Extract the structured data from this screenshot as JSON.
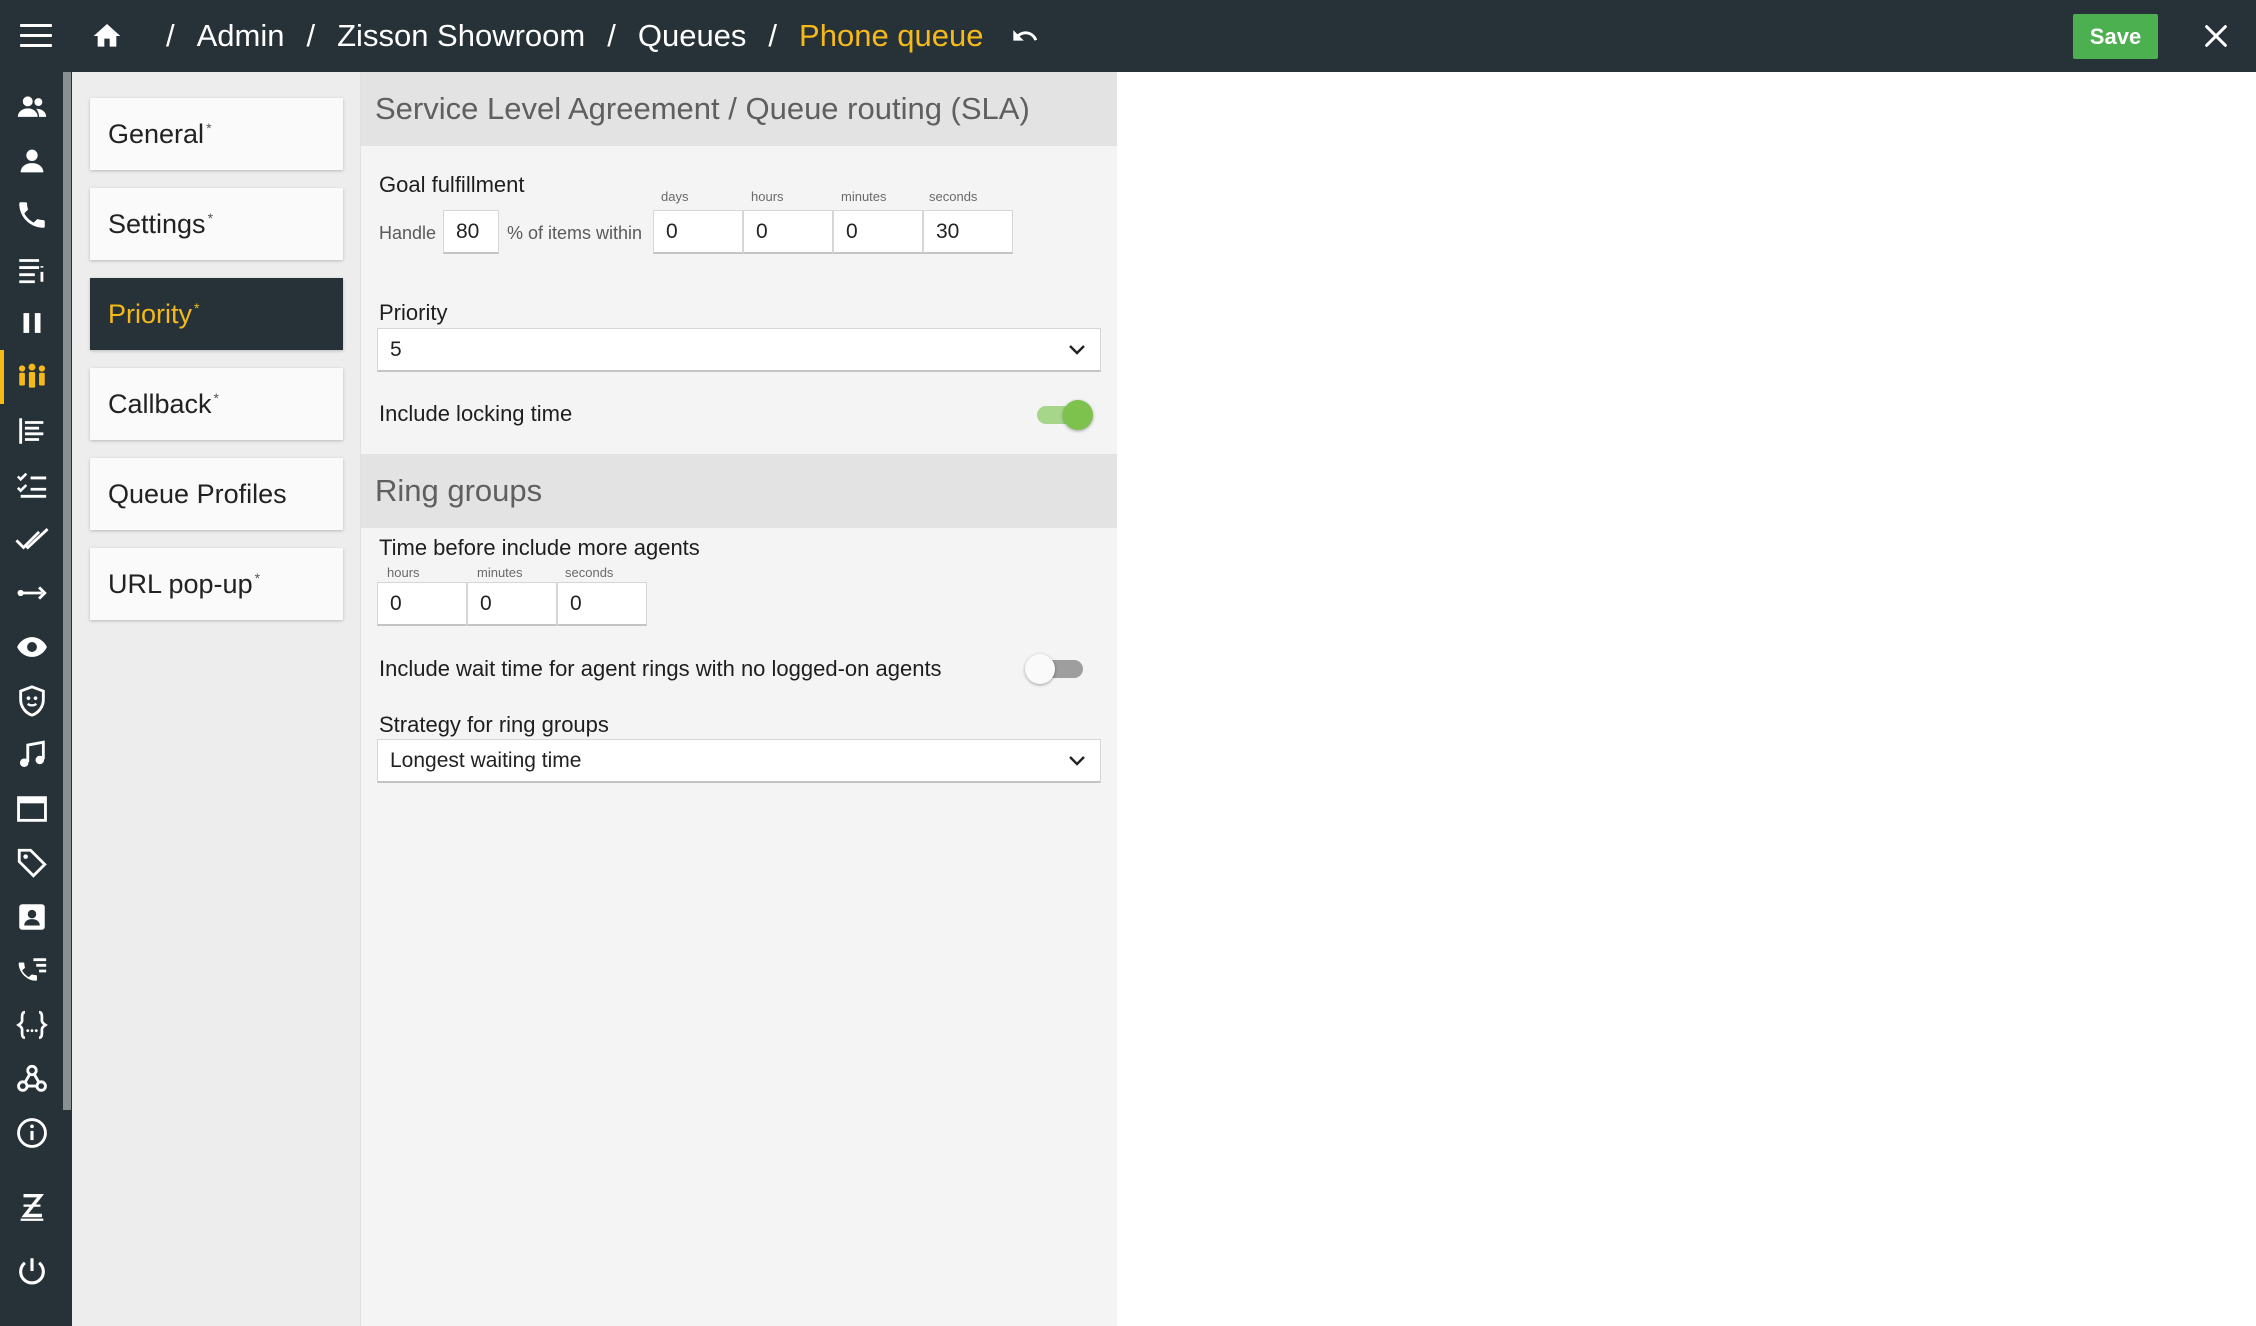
{
  "breadcrumb": {
    "items": [
      "Admin",
      "Zisson Showroom",
      "Queues"
    ],
    "current": "Phone queue",
    "separator": "/"
  },
  "toolbar": {
    "save_label": "Save"
  },
  "rail": {
    "icons": [
      "users-group-icon",
      "user-icon",
      "phone-icon",
      "list-icon",
      "pause-icon",
      "queue-people-icon",
      "report-list-icon",
      "checklist-icon",
      "double-check-icon",
      "arrow-connect-icon",
      "eye-icon",
      "shield-mask-icon",
      "music-note-icon",
      "window-icon",
      "tags-icon",
      "contact-card-icon",
      "call-list-icon",
      "code-braces-icon",
      "webhook-icon",
      "info-icon",
      "zisson-logo-icon",
      "power-icon"
    ],
    "active": "queue-people-icon"
  },
  "subnav": {
    "items": [
      {
        "label": "General",
        "modified": "*"
      },
      {
        "label": "Settings",
        "modified": "*"
      },
      {
        "label": "Priority",
        "modified": "*"
      },
      {
        "label": "Callback",
        "modified": "*"
      },
      {
        "label": "Queue Profiles",
        "modified": ""
      },
      {
        "label": "URL pop-up",
        "modified": "*"
      }
    ],
    "active": "Priority"
  },
  "sla": {
    "title": "Service Level Agreement / Queue routing (SLA)",
    "goal_label": "Goal fulfillment",
    "handle_label": "Handle",
    "percent_value": "80",
    "items_within_label": "% of items within",
    "time_units": [
      "days",
      "hours",
      "minutes",
      "seconds"
    ],
    "time_values": [
      "0",
      "0",
      "0",
      "30"
    ],
    "priority_label": "Priority",
    "priority_value": "5",
    "locking_label": "Include locking time",
    "locking_on": true
  },
  "ring": {
    "title": "Ring groups",
    "time_before_label": "Time before include more agents",
    "time_units": [
      "hours",
      "minutes",
      "seconds"
    ],
    "time_values": [
      "0",
      "0",
      "0"
    ],
    "wait_time_label": "Include wait time for agent rings with no logged-on agents",
    "wait_time_on": false,
    "strategy_label": "Strategy for ring groups",
    "strategy_value": "Longest waiting time"
  },
  "colors": {
    "topbar": "#263238",
    "accent": "#f6b91a",
    "save": "#4caf50",
    "toggle_on": "#7dc24d"
  }
}
